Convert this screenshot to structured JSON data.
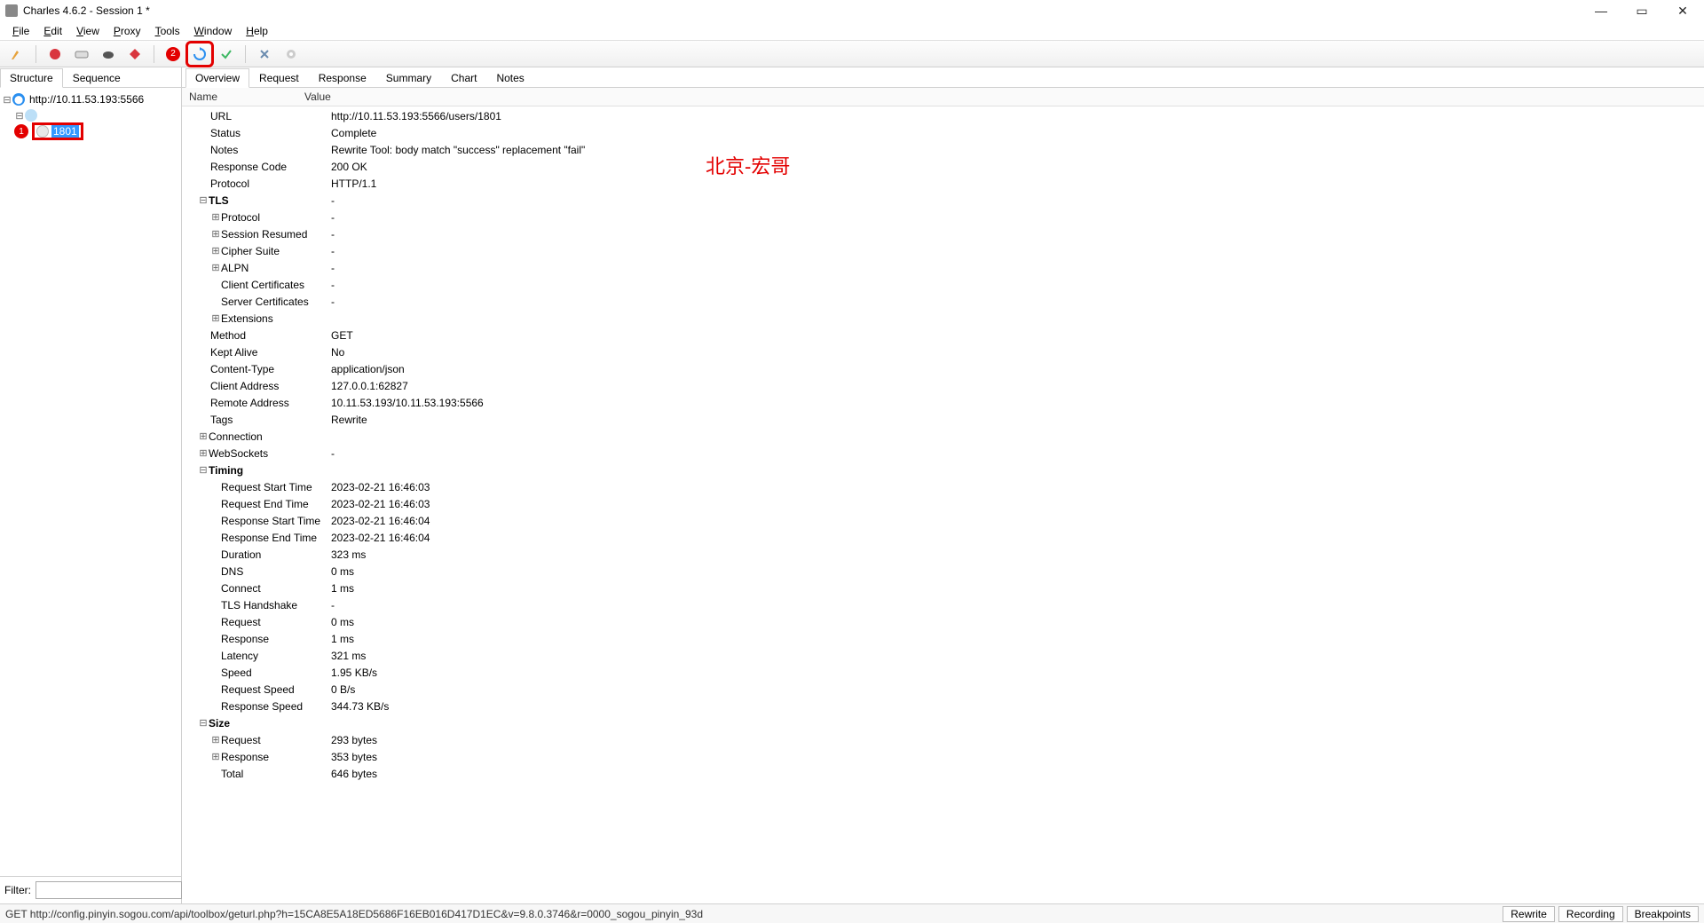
{
  "window": {
    "title": "Charles 4.6.2 - Session 1 *"
  },
  "menu": {
    "file": "File",
    "edit": "Edit",
    "view": "View",
    "proxy": "Proxy",
    "tools": "Tools",
    "window": "Window",
    "help": "Help"
  },
  "sidebar": {
    "tabs": {
      "structure": "Structure",
      "sequence": "Sequence"
    },
    "host": "http://10.11.53.193:5566",
    "leaf": "1801",
    "filter_label": "Filter:",
    "filter_value": ""
  },
  "content_tabs": {
    "overview": "Overview",
    "request": "Request",
    "response": "Response",
    "summary": "Summary",
    "chart": "Chart",
    "notes": "Notes"
  },
  "headers": {
    "name": "Name",
    "value": "Value"
  },
  "overview": {
    "url_k": "URL",
    "url_v": "http://10.11.53.193:5566/users/1801",
    "status_k": "Status",
    "status_v": "Complete",
    "notes_k": "Notes",
    "notes_v": "Rewrite Tool: body match \"success\" replacement \"fail\"",
    "respcode_k": "Response Code",
    "respcode_v": "200 OK",
    "protocol_k": "Protocol",
    "protocol_v": "HTTP/1.1",
    "tls_k": "TLS",
    "tls_v": "-",
    "tls_proto_k": "Protocol",
    "tls_proto_v": "-",
    "tls_sess_k": "Session Resumed",
    "tls_sess_v": "-",
    "tls_cipher_k": "Cipher Suite",
    "tls_cipher_v": "-",
    "tls_alpn_k": "ALPN",
    "tls_alpn_v": "-",
    "tls_cc_k": "Client Certificates",
    "tls_cc_v": "-",
    "tls_sc_k": "Server Certificates",
    "tls_sc_v": "-",
    "tls_ext_k": "Extensions",
    "method_k": "Method",
    "method_v": "GET",
    "kept_k": "Kept Alive",
    "kept_v": "No",
    "ctype_k": "Content-Type",
    "ctype_v": "application/json",
    "caddr_k": "Client Address",
    "caddr_v": "127.0.0.1:62827",
    "raddr_k": "Remote Address",
    "raddr_v": "10.11.53.193/10.11.53.193:5566",
    "tags_k": "Tags",
    "tags_v": "Rewrite",
    "conn_k": "Connection",
    "ws_k": "WebSockets",
    "ws_v": "-",
    "timing_k": "Timing",
    "rst_k": "Request Start Time",
    "rst_v": "2023-02-21 16:46:03",
    "ret_k": "Request End Time",
    "ret_v": "2023-02-21 16:46:03",
    "rsst_k": "Response Start Time",
    "rsst_v": "2023-02-21 16:46:04",
    "rset_k": "Response End Time",
    "rset_v": "2023-02-21 16:46:04",
    "dur_k": "Duration",
    "dur_v": "323 ms",
    "dns_k": "DNS",
    "dns_v": "0 ms",
    "connect_k": "Connect",
    "connect_v": "1 ms",
    "tlshs_k": "TLS Handshake",
    "tlshs_v": "-",
    "treq_k": "Request",
    "treq_v": "0 ms",
    "tresp_k": "Response",
    "tresp_v": "1 ms",
    "lat_k": "Latency",
    "lat_v": "321 ms",
    "speed_k": "Speed",
    "speed_v": "1.95 KB/s",
    "reqspeed_k": "Request Speed",
    "reqspeed_v": "0 B/s",
    "respspeed_k": "Response Speed",
    "respspeed_v": "344.73 KB/s",
    "size_k": "Size",
    "sreq_k": "Request",
    "sreq_v": "293 bytes",
    "sresp_k": "Response",
    "sresp_v": "353 bytes",
    "stotal_k": "Total",
    "stotal_v": "646 bytes"
  },
  "annotation": "北京-宏哥",
  "statusbar": {
    "text": "GET http://config.pinyin.sogou.com/api/toolbox/geturl.php?h=15CA8E5A18ED5686F16EB016D417D1EC&v=9.8.0.3746&r=0000_sogou_pinyin_93d",
    "rewrite": "Rewrite",
    "recording": "Recording",
    "breakpoints": "Breakpoints"
  },
  "badges": {
    "one": "1",
    "two": "2"
  }
}
